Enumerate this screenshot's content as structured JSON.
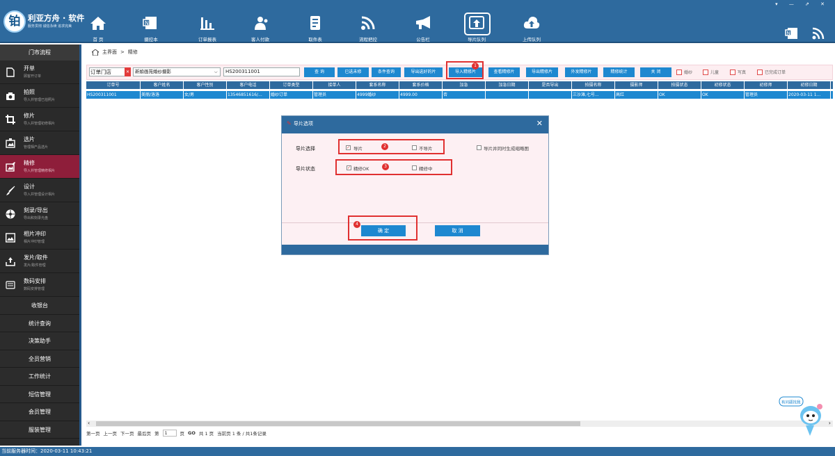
{
  "app": {
    "logo_char": "铂",
    "brand": "利亚方舟 · 软件",
    "slogan": "服务贯彻  诚信永续  追求完美"
  },
  "nav": [
    {
      "label": "首 页",
      "icon": "home-icon"
    },
    {
      "label": "摄控本",
      "icon": "camera-book-icon"
    },
    {
      "label": "订单报表",
      "icon": "bar-chart-icon"
    },
    {
      "label": "客人付款",
      "icon": "customers-icon"
    },
    {
      "label": "取件表",
      "icon": "pickup-list-icon"
    },
    {
      "label": "流程把控",
      "icon": "flow-control-icon"
    },
    {
      "label": "公告栏",
      "icon": "megaphone-icon"
    },
    {
      "label": "导片队列",
      "icon": "upload-queue-icon"
    },
    {
      "label": "上传队列",
      "icon": "cloud-upload-icon"
    }
  ],
  "window_controls": "▾ — ⇗ ✕",
  "sidebar": {
    "header": "门市流程",
    "items": [
      {
        "title": "开单",
        "sub": "顾客开订单",
        "icon": "order-doc-icon",
        "active": false
      },
      {
        "title": "拍照",
        "sub": "导入并管理已拍照片",
        "icon": "camera-icon",
        "active": false
      },
      {
        "title": "修片",
        "sub": "导入并管理初修相片",
        "icon": "crop-icon",
        "active": false
      },
      {
        "title": "选片",
        "sub": "管理相产品选片",
        "icon": "select-photo-icon",
        "active": false
      },
      {
        "title": "精修",
        "sub": "导入并管理精修相片",
        "icon": "retouch-icon",
        "active": true
      },
      {
        "title": "设计",
        "sub": "导入并管理设计相片",
        "icon": "brush-icon",
        "active": false
      },
      {
        "title": "刻录/导出",
        "sub": "导出和刻录光盘",
        "icon": "disc-icon",
        "active": false
      },
      {
        "title": "相片冲印",
        "sub": "相片冲印管理",
        "icon": "print-photo-icon",
        "active": false
      },
      {
        "title": "发片/取件",
        "sub": "发片/取件管理",
        "icon": "tray-icon",
        "active": false
      },
      {
        "title": "数码安排",
        "sub": "数码安排管理",
        "icon": "digital-icon",
        "active": false
      }
    ],
    "simple_items": [
      "收银台",
      "统计查询",
      "决策助手",
      "全员营销",
      "工作统计",
      "短信管理",
      "会员管理",
      "服装管理"
    ]
  },
  "breadcrumb": {
    "home": "主界面",
    "sep": ">",
    "current": "精修"
  },
  "toolbar": {
    "store": "订单门店",
    "studio": "新娘画苑婚纱摄影",
    "order_no": "HS200311001",
    "buttons": [
      "查 询",
      "已选未修",
      "条件查询",
      "导出选好的片",
      "导入精修片",
      "查看精修片",
      "导出精修片",
      "外发精修片",
      "精修统计",
      "关 闭"
    ],
    "checkboxes": [
      "婚纱",
      "儿童",
      "写真",
      "已完成订单"
    ],
    "badge": "1"
  },
  "grid": {
    "columns": [
      "订单号",
      "客户姓名",
      "客户性别",
      "客户电话",
      "订单类型",
      "接单人",
      "套系名称",
      "套系价格",
      "加急",
      "加急日期",
      "是否导出",
      "拍摄名称",
      "摄影师",
      "拍摄状态",
      "初修状态",
      "初修师",
      "初修日期"
    ],
    "rows": [
      [
        "HS200311001",
        "美丽/洛洛",
        "女/男",
        "13546851616/...",
        "婚纱订单",
        "管理员",
        "4999婚纱",
        "4999.00",
        "否",
        "",
        "",
        "三沙滩,七号...",
        "高红",
        "OK",
        "OK",
        "管理员",
        "2020-03-11 1..."
      ]
    ]
  },
  "pager": {
    "first": "第一页",
    "prev": "上一页",
    "next": "下一页",
    "last": "最后页",
    "page_prefix": "第",
    "page_value": "1",
    "page_suffix": "页",
    "go": "GO",
    "total": "共 1 页",
    "current_info": "当前页 1 条 / 共1条记录"
  },
  "dialog": {
    "title": "导片选项",
    "close": "✕",
    "row1_label": "导片选择",
    "opt_import": "导片",
    "opt_no_import": "不导片",
    "opt_thumb": "导片并同时生成缩略图",
    "row2_label": "导片状态",
    "opt_ok": "精修OK",
    "opt_in_progress": "精修中",
    "ok": "确 定",
    "cancel": "取 消",
    "badges": [
      "2",
      "3",
      "4"
    ],
    "checked": {
      "import": true,
      "no_import": false,
      "thumb": false,
      "ok": true,
      "in_progress": false
    }
  },
  "status_bar": "当前服务器时间：2020-03-11 10:43:21",
  "mascot_text": "有问题找我"
}
